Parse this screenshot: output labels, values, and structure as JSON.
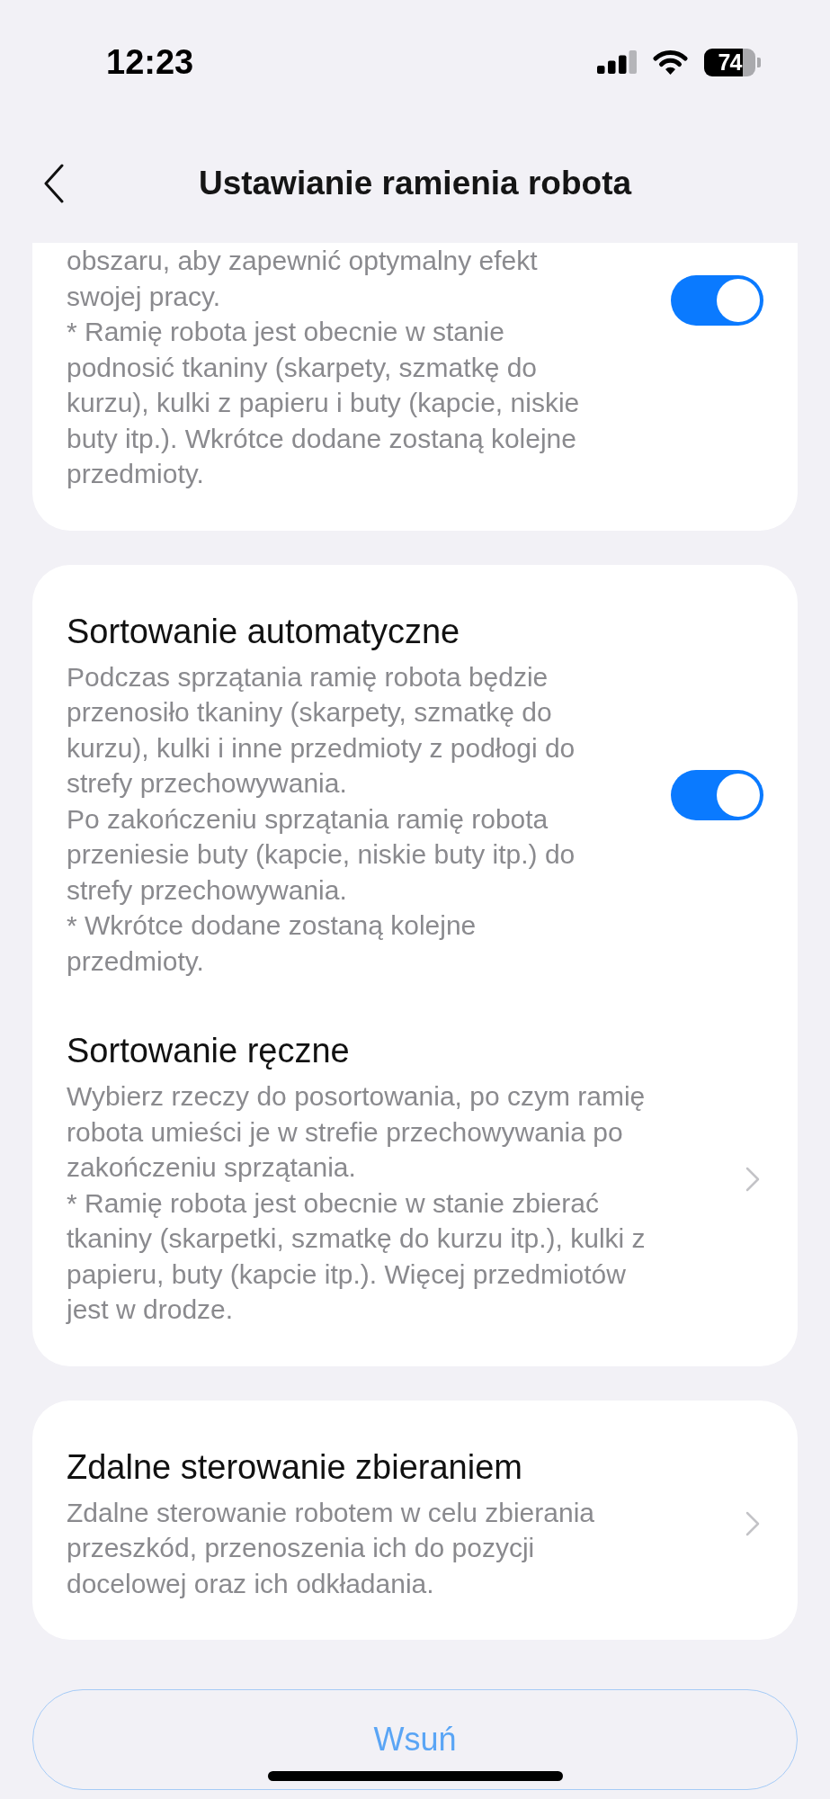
{
  "status_bar": {
    "time": "12:23",
    "battery": "74"
  },
  "header": {
    "title": "Ustawianie ramienia robota"
  },
  "cards": [
    {
      "cut_off": true,
      "sections": [
        {
          "kind": "toggle",
          "description": "obszaru, aby zapewnić optymalny efekt swojej pracy.\n* Ramię robota jest obecnie w stanie podnosić tkaniny (skarpety, szmatkę do kurzu), kulki z papieru i buty (kapcie, niskie buty itp.). Wkrótce dodane zostaną kolejne przedmioty.",
          "on": true
        }
      ]
    },
    {
      "cut_off": false,
      "sections": [
        {
          "kind": "toggle",
          "title": "Sortowanie automatyczne",
          "description": "Podczas sprzątania ramię robota będzie przenosiło tkaniny (skarpety, szmatkę do kurzu), kulki i inne przedmioty z podłogi do strefy przechowywania.\nPo zakończeniu sprzątania ramię robota przeniesie buty (kapcie, niskie buty itp.) do strefy przechowywania.\n* Wkrótce dodane zostaną kolejne przedmioty.",
          "on": true
        },
        {
          "kind": "link",
          "title": "Sortowanie ręczne",
          "description": "Wybierz rzeczy do posortowania, po czym ramię robota umieści je w strefie przechowywania po zakończeniu sprzątania.\n* Ramię robota jest obecnie w stanie zbierać tkaniny (skarpetki, szmatkę do kurzu itp.), kulki z papieru, buty (kapcie itp.). Więcej przedmiotów jest w drodze."
        }
      ]
    },
    {
      "cut_off": false,
      "sections": [
        {
          "kind": "link",
          "title": "Zdalne sterowanie zbieraniem",
          "description": "Zdalne sterowanie robotem w celu zbierania przeszkód, przenoszenia ich do pozycji docelowej oraz ich odkładania."
        }
      ]
    }
  ],
  "button": {
    "label": "Wsuń"
  }
}
